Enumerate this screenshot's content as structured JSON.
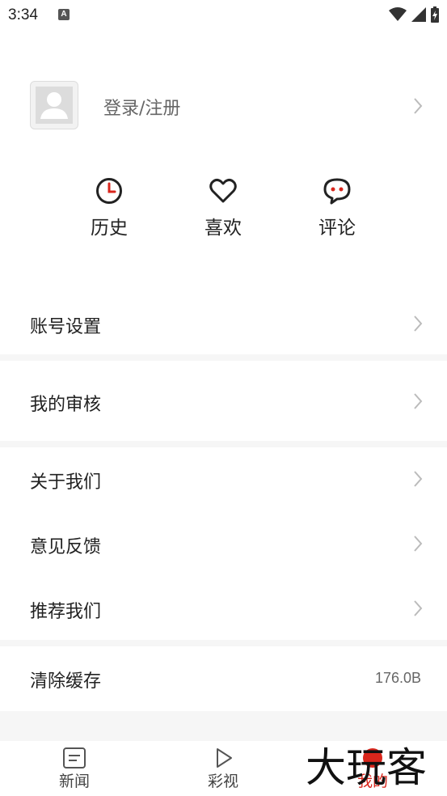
{
  "status_bar": {
    "time": "3:34",
    "notification_icon": "A"
  },
  "profile": {
    "login_label": "登录/注册"
  },
  "quick_actions": [
    {
      "icon": "clock-icon",
      "label": "历史"
    },
    {
      "icon": "heart-icon",
      "label": "喜欢"
    },
    {
      "icon": "comment-icon",
      "label": "评论"
    }
  ],
  "menu": {
    "account_settings": "账号设置",
    "my_review": "我的审核",
    "about_us": "关于我们",
    "feedback": "意见反馈",
    "recommend_us": "推荐我们",
    "clear_cache": "清除缓存",
    "cache_size": "176.0B"
  },
  "tabs": [
    {
      "label": "新闻",
      "icon": "news-icon",
      "active": false
    },
    {
      "label": "彩视",
      "icon": "play-icon",
      "active": false
    },
    {
      "label": "我的",
      "icon": "profile-icon",
      "active": true
    }
  ],
  "watermark": "大玩客",
  "colors": {
    "accent": "#d9261c",
    "icon": "#222222",
    "background_gap": "#f6f6f6"
  }
}
